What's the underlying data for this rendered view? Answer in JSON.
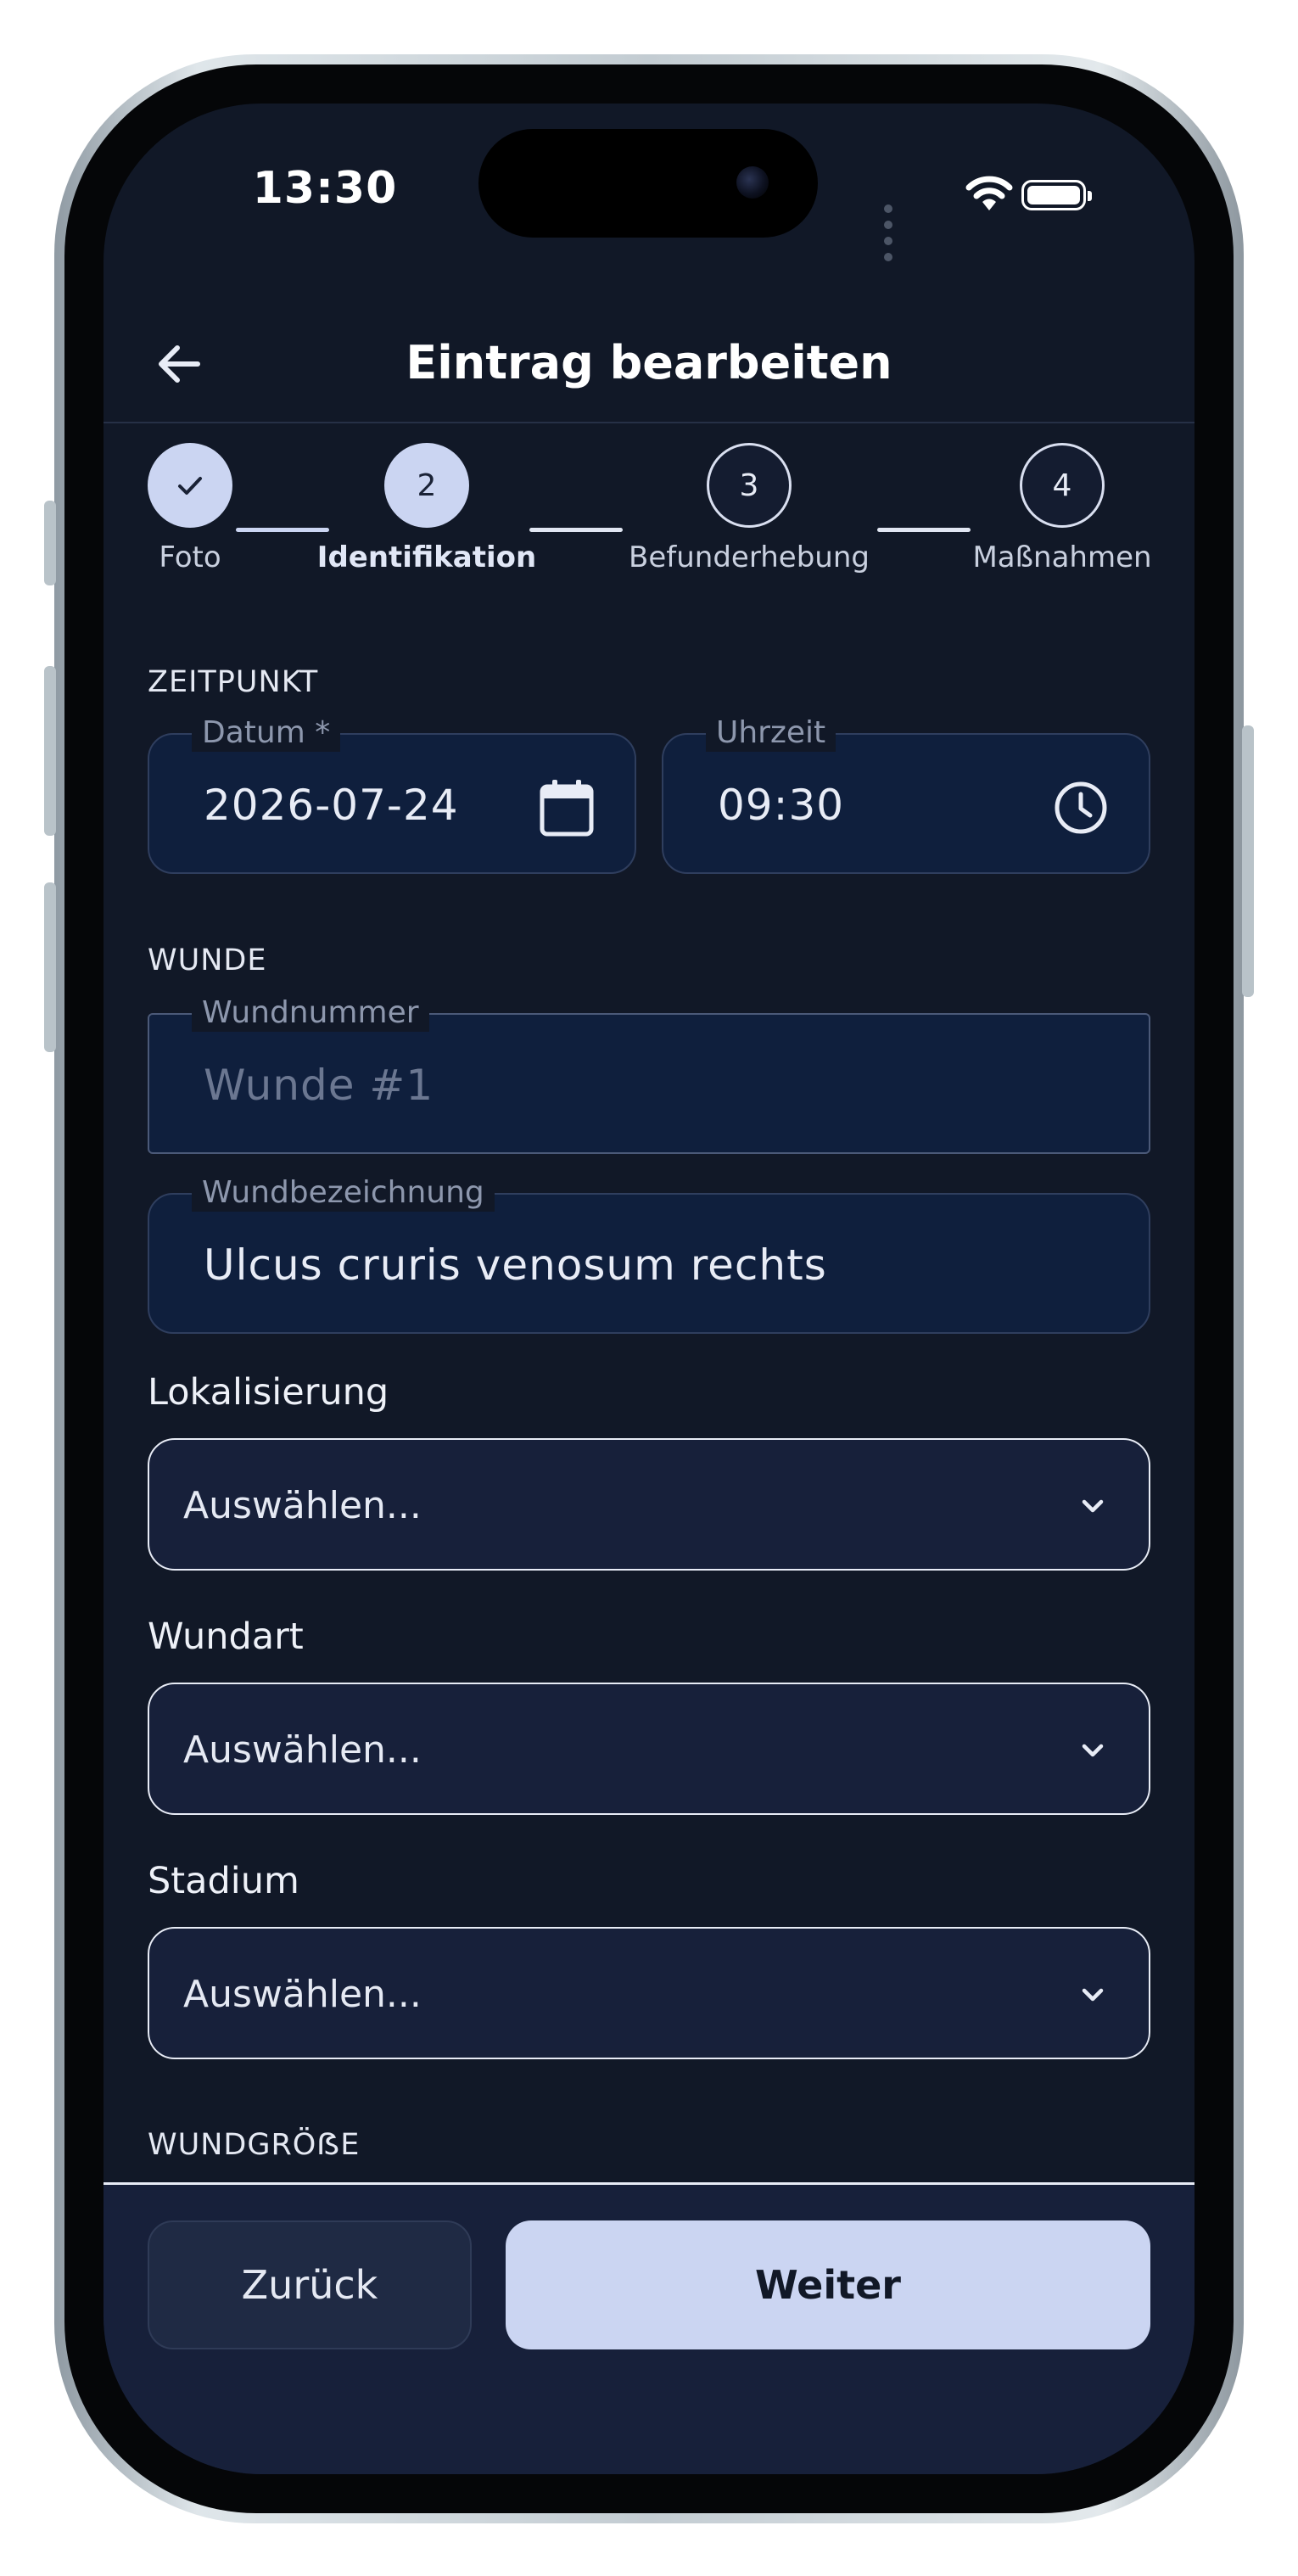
{
  "status_bar": {
    "time": "13:30"
  },
  "app_bar": {
    "title": "Eintrag bearbeiten"
  },
  "stepper": {
    "steps": [
      {
        "label": "Foto",
        "number": "",
        "state": "done"
      },
      {
        "label": "Identifikation",
        "number": "2",
        "state": "active"
      },
      {
        "label": "Befunderhebung",
        "number": "3",
        "state": "todo"
      },
      {
        "label": "Maßnahmen",
        "number": "4",
        "state": "todo"
      }
    ]
  },
  "zeitpunkt": {
    "section_title": "ZEITPUNKT",
    "date": {
      "label": "Datum *",
      "value": "2026-07-24"
    },
    "time": {
      "label": "Uhrzeit",
      "value": "09:30"
    }
  },
  "wunde": {
    "section_title": "WUNDE",
    "wound_number": {
      "label": "Wundnummer",
      "placeholder": "Wunde #1"
    },
    "wound_name": {
      "label": "Wundbezeichnung",
      "value": "Ulcus cruris venosum rechts"
    }
  },
  "selects": {
    "localization": {
      "label": "Lokalisierung",
      "value": "Auswählen..."
    },
    "wound_type": {
      "label": "Wundart",
      "value": "Auswählen..."
    },
    "stage": {
      "label": "Stadium",
      "value": "Auswählen..."
    }
  },
  "wound_size": {
    "section_title": "WUNDGRÖẞE"
  },
  "footer": {
    "back_label": "Zurück",
    "next_label": "Weiter"
  },
  "colors": {
    "accent": "#cbd5f2",
    "background": "#111827",
    "field": "#0f1f3d"
  }
}
